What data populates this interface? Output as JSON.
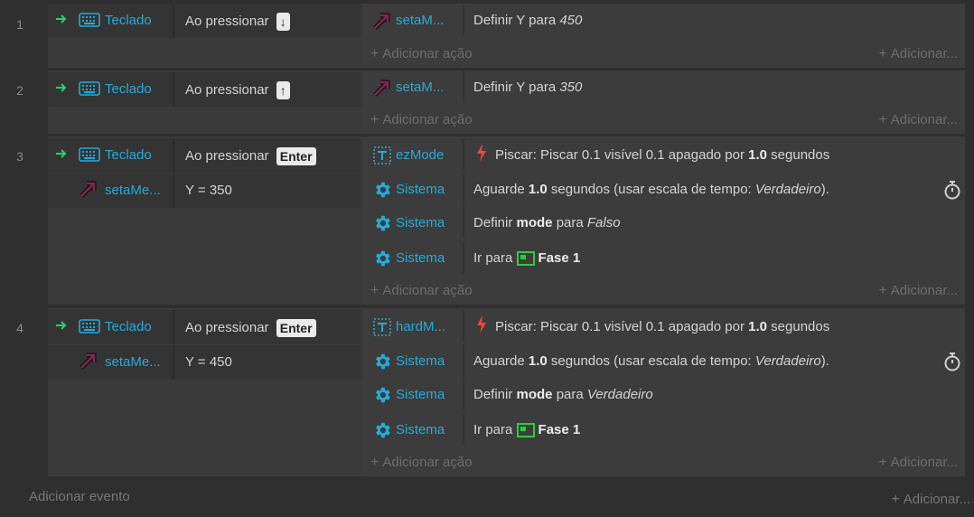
{
  "events": [
    {
      "number": "1",
      "conditions": [
        {
          "object": "Teclado",
          "text": "Ao pressionar",
          "key": "↓"
        }
      ],
      "actions": [
        {
          "object": "setaM...",
          "parts": [
            {
              "t": "Definir Y para "
            },
            {
              "t": "450",
              "style": "it"
            }
          ]
        }
      ]
    },
    {
      "number": "2",
      "conditions": [
        {
          "object": "Teclado",
          "text": "Ao pressionar",
          "key": "↑"
        }
      ],
      "actions": [
        {
          "object": "setaM...",
          "parts": [
            {
              "t": "Definir Y para "
            },
            {
              "t": "350",
              "style": "it"
            }
          ]
        }
      ]
    },
    {
      "number": "3",
      "conditions": [
        {
          "object": "Teclado",
          "text": "Ao pressionar",
          "key": "Enter"
        },
        {
          "object": "setaMe...",
          "text": "Y = 350"
        }
      ],
      "actions": [
        {
          "object": "ezMode",
          "parts": [
            {
              "t": "Piscar: Piscar 0.1 visível 0.1 apagado por "
            },
            {
              "t": "1.0",
              "style": "b"
            },
            {
              "t": " segundos"
            }
          ]
        },
        {
          "object": "Sistema",
          "parts": [
            {
              "t": "Aguarde "
            },
            {
              "t": "1.0",
              "style": "b"
            },
            {
              "t": " segundos (usar escala de tempo: "
            },
            {
              "t": "Verdadeiro",
              "style": "it"
            },
            {
              "t": ")."
            }
          ]
        },
        {
          "object": "Sistema",
          "parts": [
            {
              "t": "Definir "
            },
            {
              "t": "mode",
              "style": "b"
            },
            {
              "t": " para "
            },
            {
              "t": "Falso",
              "style": "it"
            }
          ]
        },
        {
          "object": "Sistema",
          "parts": [
            {
              "t": "Ir para "
            },
            {
              "t": "Fase 1",
              "style": "b"
            }
          ]
        }
      ]
    },
    {
      "number": "4",
      "conditions": [
        {
          "object": "Teclado",
          "text": "Ao pressionar",
          "key": "Enter"
        },
        {
          "object": "setaMe...",
          "text": "Y = 450"
        }
      ],
      "actions": [
        {
          "object": "hardM...",
          "parts": [
            {
              "t": "Piscar: Piscar 0.1 visível 0.1 apagado por "
            },
            {
              "t": "1.0",
              "style": "b"
            },
            {
              "t": " segundos"
            }
          ]
        },
        {
          "object": "Sistema",
          "parts": [
            {
              "t": "Aguarde "
            },
            {
              "t": "1.0",
              "style": "b"
            },
            {
              "t": " segundos (usar escala de tempo: "
            },
            {
              "t": "Verdadeiro",
              "style": "it"
            },
            {
              "t": ")."
            }
          ]
        },
        {
          "object": "Sistema",
          "parts": [
            {
              "t": "Definir "
            },
            {
              "t": "mode",
              "style": "b"
            },
            {
              "t": " para "
            },
            {
              "t": "Verdadeiro",
              "style": "it"
            }
          ]
        },
        {
          "object": "Sistema",
          "parts": [
            {
              "t": "Ir para "
            },
            {
              "t": "Fase 1",
              "style": "b"
            }
          ]
        }
      ]
    }
  ],
  "labels": {
    "add_action": "Adicionar ação",
    "add_right": "Adicionar...",
    "add_event": "Adicionar evento",
    "add_bottom_right": "Adicionar..."
  },
  "colors": {
    "object_link": "#29a9d8",
    "arrow_green": "#2ecc71",
    "flash_red": "#e74c3c",
    "scene_green": "#2ecc40"
  }
}
